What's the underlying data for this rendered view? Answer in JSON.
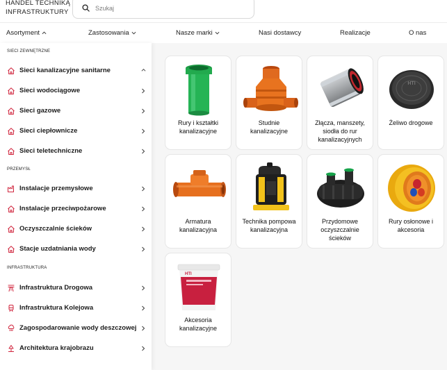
{
  "brand": {
    "line1": "HANDEL TECHNIKĄ",
    "line2": "INFRASTRUKTURY"
  },
  "search": {
    "placeholder": "Szukaj",
    "value": "",
    "icon": "search-icon"
  },
  "nav": [
    {
      "label": "Asortyment",
      "chevron": "up"
    },
    {
      "label": "Zastosowania",
      "chevron": "down"
    },
    {
      "label": "Nasze marki",
      "chevron": "down"
    },
    {
      "label": "Nasi dostawcy"
    },
    {
      "label": "Realizacje"
    },
    {
      "label": "O nas"
    }
  ],
  "sidebar": {
    "sections": [
      {
        "title": "SIECI ZEWNĘTRZNE",
        "items": [
          {
            "label": "Sieci kanalizacyjne sanitarne",
            "icon": "house-icon",
            "chevron": "up"
          },
          {
            "label": "Sieci wodociągowe",
            "icon": "house-icon",
            "chevron": "right"
          },
          {
            "label": "Sieci gazowe",
            "icon": "house-icon",
            "chevron": "right"
          },
          {
            "label": "Sieci ciepłownicze",
            "icon": "house-icon",
            "chevron": "right"
          },
          {
            "label": "Sieci teletechniczne",
            "icon": "house-icon",
            "chevron": "right"
          }
        ]
      },
      {
        "title": "PRZEMYSŁ",
        "items": [
          {
            "label": "Instalacje przemysłowe",
            "icon": "factory-icon",
            "chevron": "right"
          },
          {
            "label": "Instalacje przeciwpożarowe",
            "icon": "house-icon",
            "chevron": "right"
          },
          {
            "label": "Oczyszczalnie ścieków",
            "icon": "house-icon",
            "chevron": "right"
          },
          {
            "label": "Stacje uzdatniania wody",
            "icon": "house-icon",
            "chevron": "right"
          }
        ]
      },
      {
        "title": "INFRASTRUKTURA",
        "items": [
          {
            "label": "Infrastruktura Drogowa",
            "icon": "road-icon",
            "chevron": "right"
          },
          {
            "label": "Infrastruktura Kolejowa",
            "icon": "train-icon",
            "chevron": "right"
          },
          {
            "label": "Zagospodarowanie wody deszczowej",
            "icon": "rain-icon",
            "chevron": "right"
          },
          {
            "label": "Architektura krajobrazu",
            "icon": "landscape-icon",
            "chevron": "right"
          }
        ]
      }
    ]
  },
  "products": [
    {
      "title": "Rury i kształtki kanalizacyjne",
      "image": "green-pipe"
    },
    {
      "title": "Studnie kanalizacyjne",
      "image": "orange-well"
    },
    {
      "title": "Złącza, manszety, siodła do rur kanalizacyjnych",
      "image": "pipe-coupling"
    },
    {
      "title": "Żeliwo drogowe",
      "image": "manhole-cover"
    },
    {
      "title": "Armatura kanalizacyjna",
      "image": "orange-valve"
    },
    {
      "title": "Technika pompowa kanalizacyjna",
      "image": "submersible-pump"
    },
    {
      "title": "Przydomowe oczyszczalnie ścieków",
      "image": "septic-tank"
    },
    {
      "title": "Rury osłonowe i akcesoria",
      "image": "cable-conduit"
    },
    {
      "title": "Akcesoria kanalizacyjne",
      "image": "sealant-bucket"
    }
  ],
  "colors": {
    "accent": "#d0243c",
    "orange": "#e06a1f",
    "green": "#16a34a"
  }
}
